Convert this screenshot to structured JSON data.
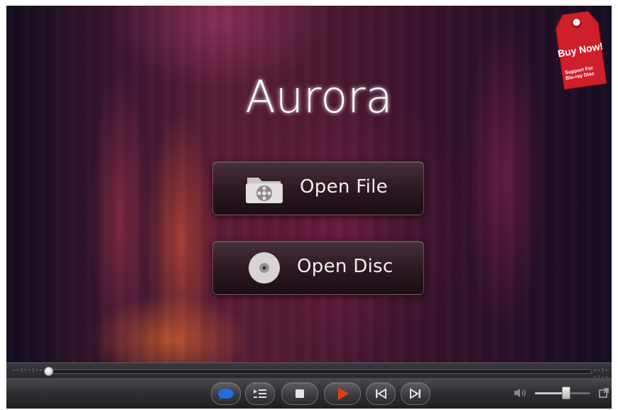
{
  "app": {
    "logo_text": "Aurora"
  },
  "main": {
    "open_file_label": "Open File",
    "open_disc_label": "Open Disc"
  },
  "promo": {
    "title": "Buy Now!",
    "subtitle_line1": "Support For",
    "subtitle_line2": "Blu-ray Disc",
    "color": "#d4212a"
  },
  "player": {
    "elapsed_time": "--:--:--",
    "total_time": "--:--:--",
    "seek_position": 0,
    "volume_level": 0.55
  },
  "controls": {
    "buttons": [
      {
        "name": "subtitle-button",
        "icon": "speech-bubble-icon"
      },
      {
        "name": "playlist-button",
        "icon": "playlist-icon"
      },
      {
        "name": "stop-button",
        "icon": "stop-icon"
      },
      {
        "name": "play-button",
        "icon": "play-icon"
      },
      {
        "name": "previous-button",
        "icon": "skip-previous-icon"
      },
      {
        "name": "next-button",
        "icon": "skip-next-icon"
      }
    ],
    "accent_play": "#e8391f",
    "accent_subtitle": "#1f6fe0"
  }
}
